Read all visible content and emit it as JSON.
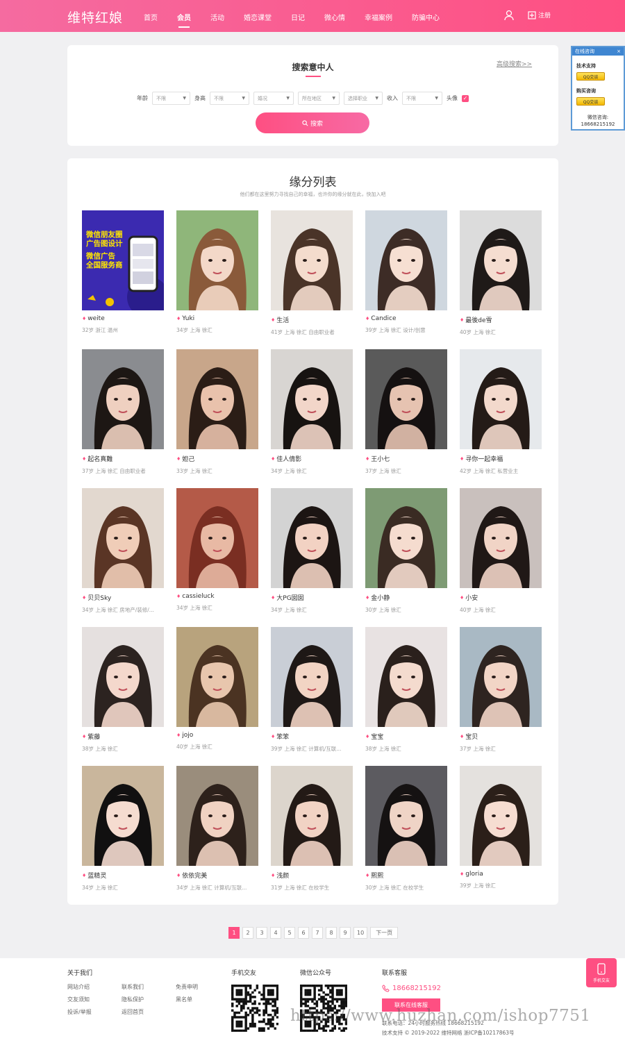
{
  "header": {
    "logo": "维特红娘",
    "nav": [
      "首页",
      "会员",
      "活动",
      "婚恋课堂",
      "日记",
      "微心情",
      "幸福案例",
      "防骗中心"
    ],
    "register": "注册"
  },
  "search": {
    "title": "搜索意中人",
    "advanced": "高级搜索>>",
    "age_label": "年龄",
    "age_value": "不限",
    "height_label": "身高",
    "height_value": "不限",
    "marital": "婚况",
    "region": "所在地区",
    "job": "选择职业",
    "income_label": "收入",
    "income_value": "不限",
    "avatar_label": "头像",
    "button": "搜索"
  },
  "list": {
    "title": "缘分列表",
    "subtitle": "他们都在这里努力寻找自己的幸福，也许你的缘分就在此，快加入吧",
    "cards": [
      {
        "name": "weite",
        "info": "32岁 浙江 温州",
        "ad": [
          "微信朋友圈",
          "广告图设计",
          "微信广告",
          "全国服务商"
        ]
      },
      {
        "name": "Yuki",
        "info": "34岁 上海 徐汇"
      },
      {
        "name": "生活",
        "info": "41岁 上海 徐汇 自由职业者"
      },
      {
        "name": "Candice",
        "info": "39岁 上海 徐汇 设计/创意"
      },
      {
        "name": "最後de雪",
        "info": "40岁 上海 徐汇"
      },
      {
        "name": "起名真難",
        "info": "37岁 上海 徐汇 自由职业者"
      },
      {
        "name": "妲己",
        "info": "33岁 上海 徐汇"
      },
      {
        "name": "佳人倩影",
        "info": "34岁 上海 徐汇"
      },
      {
        "name": "王小七",
        "info": "37岁 上海 徐汇"
      },
      {
        "name": "寻你一起幸福",
        "info": "42岁 上海 徐汇 私营业主"
      },
      {
        "name": "贝贝Sky",
        "info": "34岁 上海 徐汇 房地产/装修/..."
      },
      {
        "name": "cassieluck",
        "info": "34岁 上海 徐汇"
      },
      {
        "name": "大PG囡囡",
        "info": "34岁 上海 徐汇"
      },
      {
        "name": "金小静",
        "info": "30岁 上海 徐汇"
      },
      {
        "name": "小安",
        "info": "40岁 上海 徐汇"
      },
      {
        "name": "紫藤",
        "info": "38岁 上海 徐汇"
      },
      {
        "name": "jojo",
        "info": "40岁 上海 徐汇"
      },
      {
        "name": "笨笨",
        "info": "39岁 上海 徐汇 计算机/互联..."
      },
      {
        "name": "宝宝",
        "info": "38岁 上海 徐汇"
      },
      {
        "name": "宝贝",
        "info": "37岁 上海 徐汇"
      },
      {
        "name": "蓝精灵",
        "info": "34岁 上海 徐汇"
      },
      {
        "name": "依依完美",
        "info": "34岁 上海 徐汇 计算机/互联..."
      },
      {
        "name": "浅颜",
        "info": "31岁 上海 徐汇 在校学生"
      },
      {
        "name": "熙熙",
        "info": "30岁 上海 徐汇 在校学生"
      },
      {
        "name": "gloria",
        "info": "39岁 上海 徐汇"
      }
    ]
  },
  "pagination": {
    "pages": [
      "1",
      "2",
      "3",
      "4",
      "5",
      "6",
      "7",
      "8",
      "9",
      "10"
    ],
    "next": "下一页",
    "current": "1"
  },
  "footer": {
    "about": {
      "title": "关于我们",
      "links": [
        "网站介绍",
        "联系我们",
        "免责申明",
        "交友须知",
        "隐私保护",
        "黑名单",
        "投诉/举报",
        "返回首页"
      ]
    },
    "mobile_title": "手机交友",
    "wechat_title": "微信公众号",
    "contact": {
      "title": "联系客服",
      "phone": "18668215192",
      "button": "联系在线客服",
      "line1": "联系电话：24小时服务热线 18668215192",
      "line2": "技术支持 © 2019-2022 维特网络  浙ICP备10217863号"
    },
    "watermark": "https://www.huzhan.com/ishop7751"
  },
  "mobile_button": "手机交友",
  "consult": {
    "title": "在线咨询",
    "close": "×",
    "tech": "技术支持",
    "qq": "QQ交谈",
    "buy": "购买咨询",
    "wechat_label": "微信咨询:",
    "wechat": "18668215192"
  },
  "colors": {
    "accent": "#fe4f82",
    "consult_blue": "#3f86d1"
  }
}
